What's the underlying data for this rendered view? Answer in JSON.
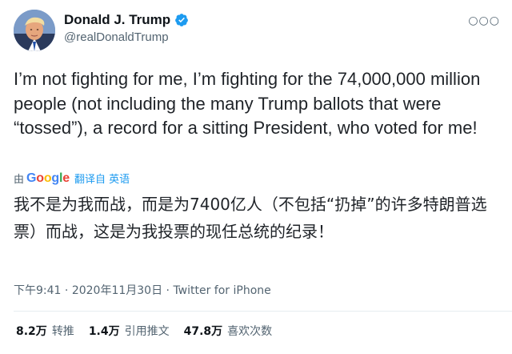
{
  "user": {
    "display_name": "Donald J. Trump",
    "handle": "@realDonaldTrump",
    "verified": true
  },
  "menu": {
    "more_icon": "more-horizontal-icon"
  },
  "tweet": {
    "text": "I’m not fighting for me, I’m fighting for the 74,000,000 million people (not including the many Trump ballots that were “tossed”), a record for a sitting President, who voted for me!",
    "translated_text": "我不是为我而战，而是为7400亿人（不包括“扔掉”的许多特朗普选票）而战，这是为我投票的现任总统的纪录！"
  },
  "translation": {
    "by": "由",
    "provider": "Google",
    "action": "翻译自 英语"
  },
  "meta": {
    "time": "下午9:41",
    "separator1": " · ",
    "date": "2020年11月30日",
    "separator2": " · ",
    "source": "Twitter for iPhone"
  },
  "stats": [
    {
      "count": "8.2万",
      "label": "转推"
    },
    {
      "count": "1.4万",
      "label": "引用推文"
    },
    {
      "count": "47.8万",
      "label": "喜欢次数"
    }
  ],
  "colors": {
    "verified_badge": "#1d9bf0",
    "link": "#1d9bf0",
    "secondary_text": "#536471",
    "primary_text": "#0f1419"
  }
}
